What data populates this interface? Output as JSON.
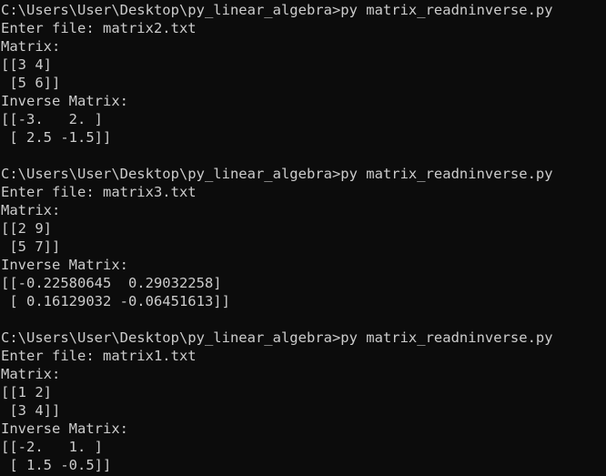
{
  "terminal": {
    "background": "#0c0c0c",
    "foreground": "#cccccc",
    "lines": [
      "C:\\Users\\User\\Desktop\\py_linear_algebra>py matrix_readninverse.py",
      "Enter file: matrix2.txt",
      "Matrix:",
      "[[3 4]",
      " [5 6]]",
      "Inverse Matrix:",
      "[[-3.   2. ]",
      " [ 2.5 -1.5]]",
      "",
      "C:\\Users\\User\\Desktop\\py_linear_algebra>py matrix_readninverse.py",
      "Enter file: matrix3.txt",
      "Matrix:",
      "[[2 9]",
      " [5 7]]",
      "Inverse Matrix:",
      "[[-0.22580645  0.29032258]",
      " [ 0.16129032 -0.06451613]]",
      "",
      "C:\\Users\\User\\Desktop\\py_linear_algebra>py matrix_readninverse.py",
      "Enter file: matrix1.txt",
      "Matrix:",
      "[[1 2]",
      " [3 4]]",
      "Inverse Matrix:",
      "[[-2.   1. ]",
      " [ 1.5 -0.5]]"
    ]
  }
}
